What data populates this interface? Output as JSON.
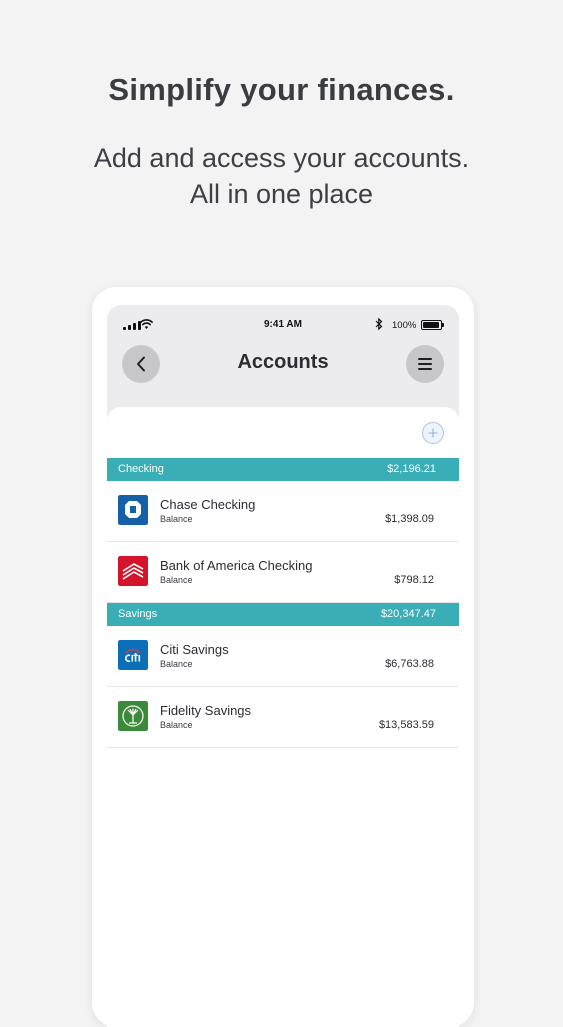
{
  "hero": {
    "headline": "Simplify your finances.",
    "subline_1": "Add and access your accounts.",
    "subline_2": "All in one place"
  },
  "status_bar": {
    "time": "9:41 AM",
    "battery": "100%"
  },
  "nav": {
    "title": "Accounts",
    "back_icon": "chevron-left-icon",
    "menu_icon": "hamburger-icon"
  },
  "colors": {
    "section_header": "#3aaeb6",
    "chase": "#1560a8",
    "bank_of_america": "#d4142a",
    "citi": "#0b6fb8",
    "fidelity": "#3a8a3a"
  },
  "sections": [
    {
      "name": "Checking",
      "total": "$2,196.21",
      "accounts": [
        {
          "name": "Chase Checking",
          "label": "Balance",
          "balance": "$1,398.09",
          "icon": "chase-logo-icon"
        },
        {
          "name": "Bank of America Checking",
          "label": "Balance",
          "balance": "$798.12",
          "icon": "bank-of-america-logo-icon"
        }
      ]
    },
    {
      "name": "Savings",
      "total": "$20,347.47",
      "accounts": [
        {
          "name": "Citi Savings",
          "label": "Balance",
          "balance": "$6,763.88",
          "icon": "citi-logo-icon"
        },
        {
          "name": "Fidelity Savings",
          "label": "Balance",
          "balance": "$13,583.59",
          "icon": "fidelity-logo-icon"
        }
      ]
    }
  ]
}
